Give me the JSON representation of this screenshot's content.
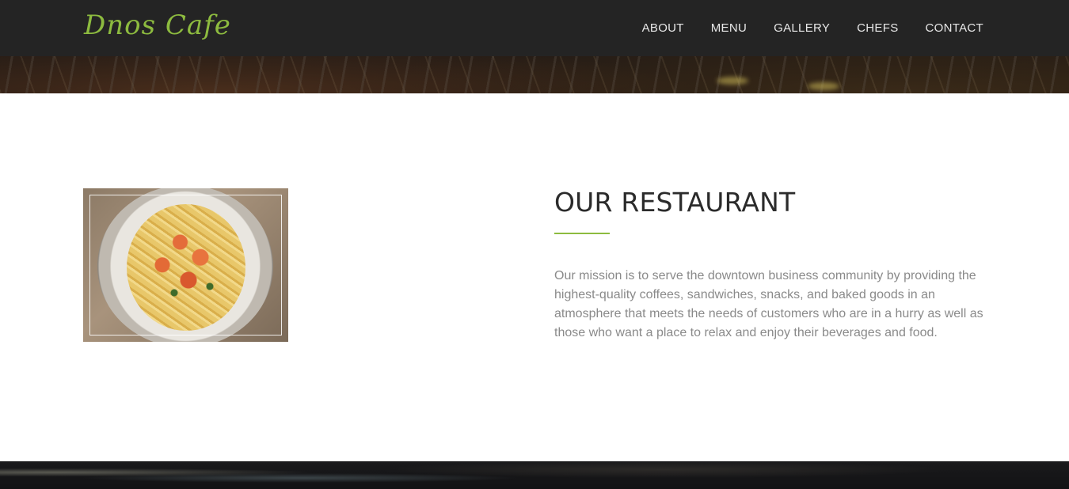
{
  "brand": {
    "logo_text": "Dnos Cafe",
    "accent_color": "#8dbb3f"
  },
  "nav": {
    "items": [
      {
        "label": "ABOUT"
      },
      {
        "label": "MENU"
      },
      {
        "label": "GALLERY"
      },
      {
        "label": "CHEFS"
      },
      {
        "label": "CONTACT"
      }
    ]
  },
  "about": {
    "title": "OUR RESTAURANT",
    "body": "Our mission is to serve the downtown business community by providing the highest-quality coffees, sandwiches, snacks, and baked goods in an atmosphere that meets the needs of customers who are in a hurry as well as those who want a place to relax and enjoy their beverages and food."
  }
}
